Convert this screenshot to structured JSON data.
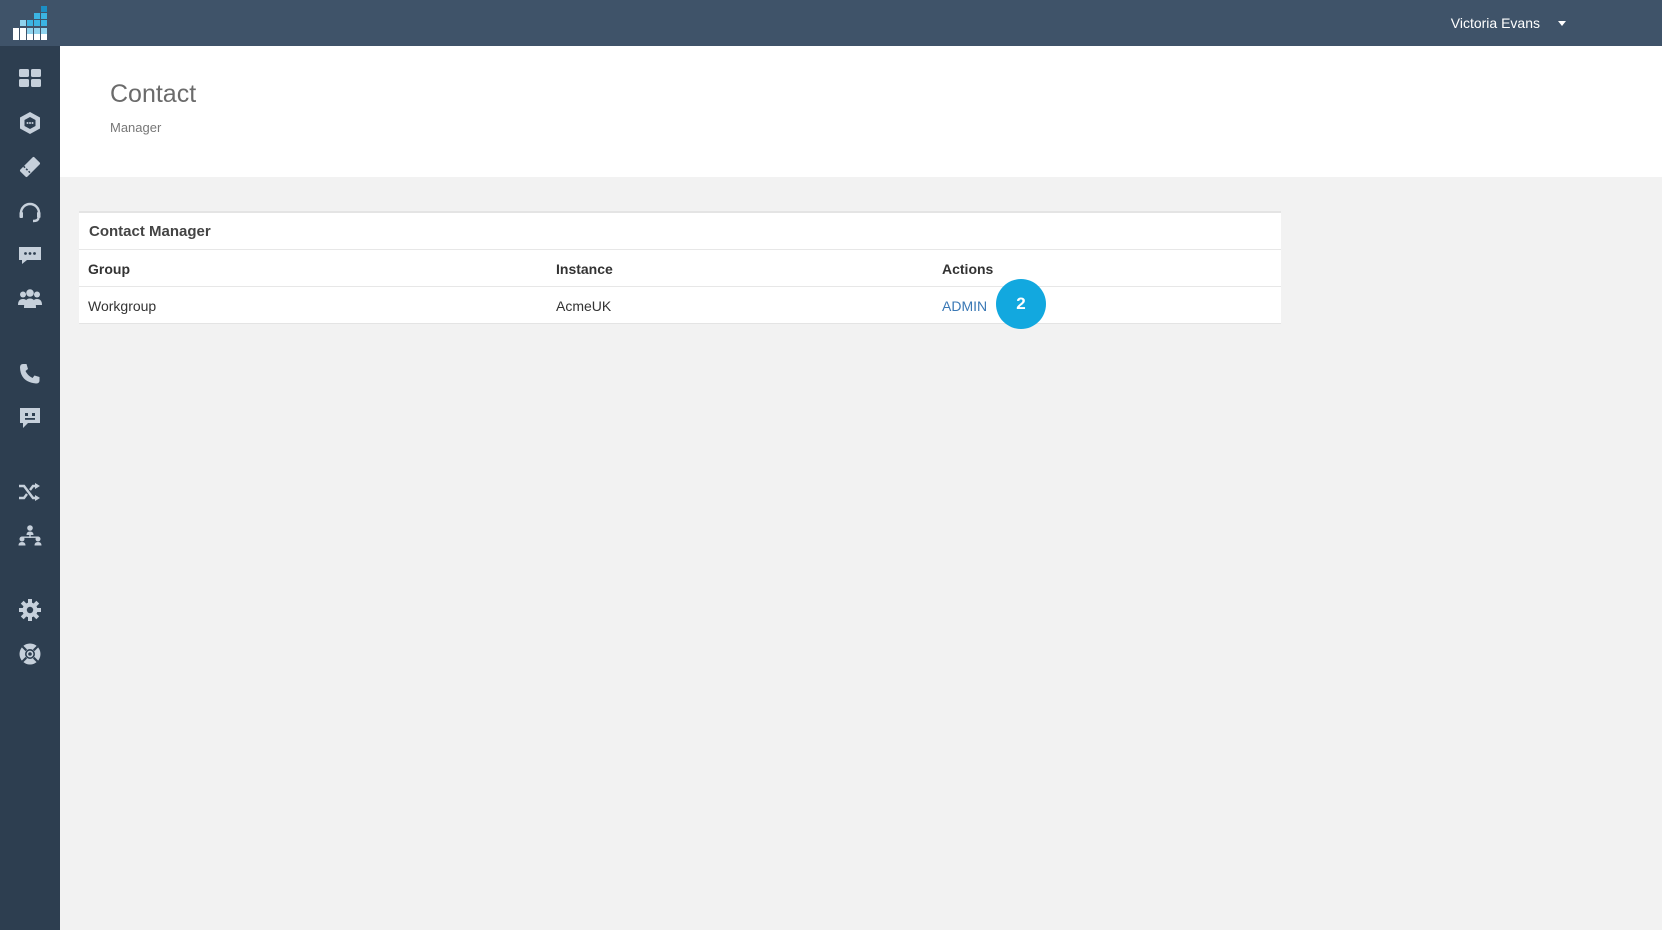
{
  "user": {
    "name": "Victoria Evans"
  },
  "page": {
    "title": "Contact",
    "subtitle": "Manager"
  },
  "panel": {
    "title": "Contact Manager",
    "columns": [
      "Group",
      "Instance",
      "Actions"
    ],
    "rows": [
      {
        "group": "Workgroup",
        "instance": "AcmeUK",
        "action": "ADMIN"
      }
    ]
  },
  "step_badge": "2",
  "sidebar": {
    "icons": [
      "dashboard-icon",
      "hexagon-chat-icon",
      "ticket-icon",
      "headset-icon",
      "chat-bubble-icon",
      "users-group-icon",
      "phone-icon",
      "message-icon",
      "shuffle-icon",
      "org-chart-icon",
      "gear-icon",
      "lifebuoy-icon"
    ]
  },
  "colors": {
    "topbar": "#3f5369",
    "sidebar": "#2d3e50",
    "icon": "#c6d0db",
    "link": "#3a78b5",
    "badge": "#12a8df"
  }
}
